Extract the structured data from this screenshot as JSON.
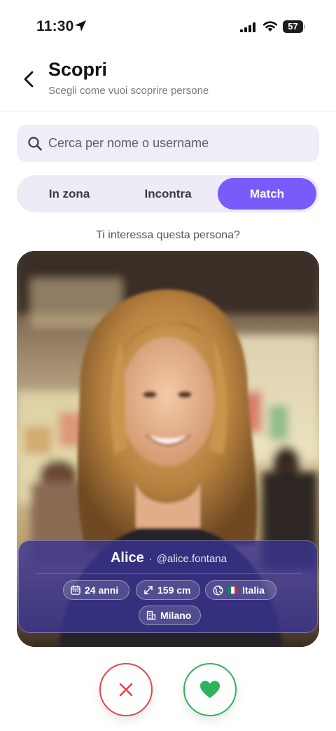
{
  "status_bar": {
    "time": "11:30",
    "battery_level": "57",
    "battery_fraction": 0.57
  },
  "header": {
    "title": "Scopri",
    "subtitle": "Scegli come vuoi scoprire persone",
    "back_icon": "chevron-left-icon"
  },
  "search": {
    "placeholder": "Cerca per nome o username",
    "value": "",
    "icon": "search-icon"
  },
  "tabs": [
    {
      "label": "In zona",
      "selected": false
    },
    {
      "label": "Incontra",
      "selected": false
    },
    {
      "label": "Match",
      "selected": true
    }
  ],
  "prompt": "Ti interessa questa persona?",
  "profile": {
    "name": "Alice",
    "separator": "·",
    "username": "@alice.fontana",
    "age": "24 anni",
    "height": "159 cm",
    "country": "Italia",
    "country_flag_colors": [
      "#009246",
      "#ffffff",
      "#ce2b37"
    ],
    "city": "Milano"
  },
  "actions": {
    "dislike_icon": "x-icon",
    "like_icon": "heart-icon"
  },
  "colors": {
    "accent": "#7a5af8",
    "dislike": "#e04848",
    "like": "#2eb25a",
    "panel": "#3a3494"
  }
}
